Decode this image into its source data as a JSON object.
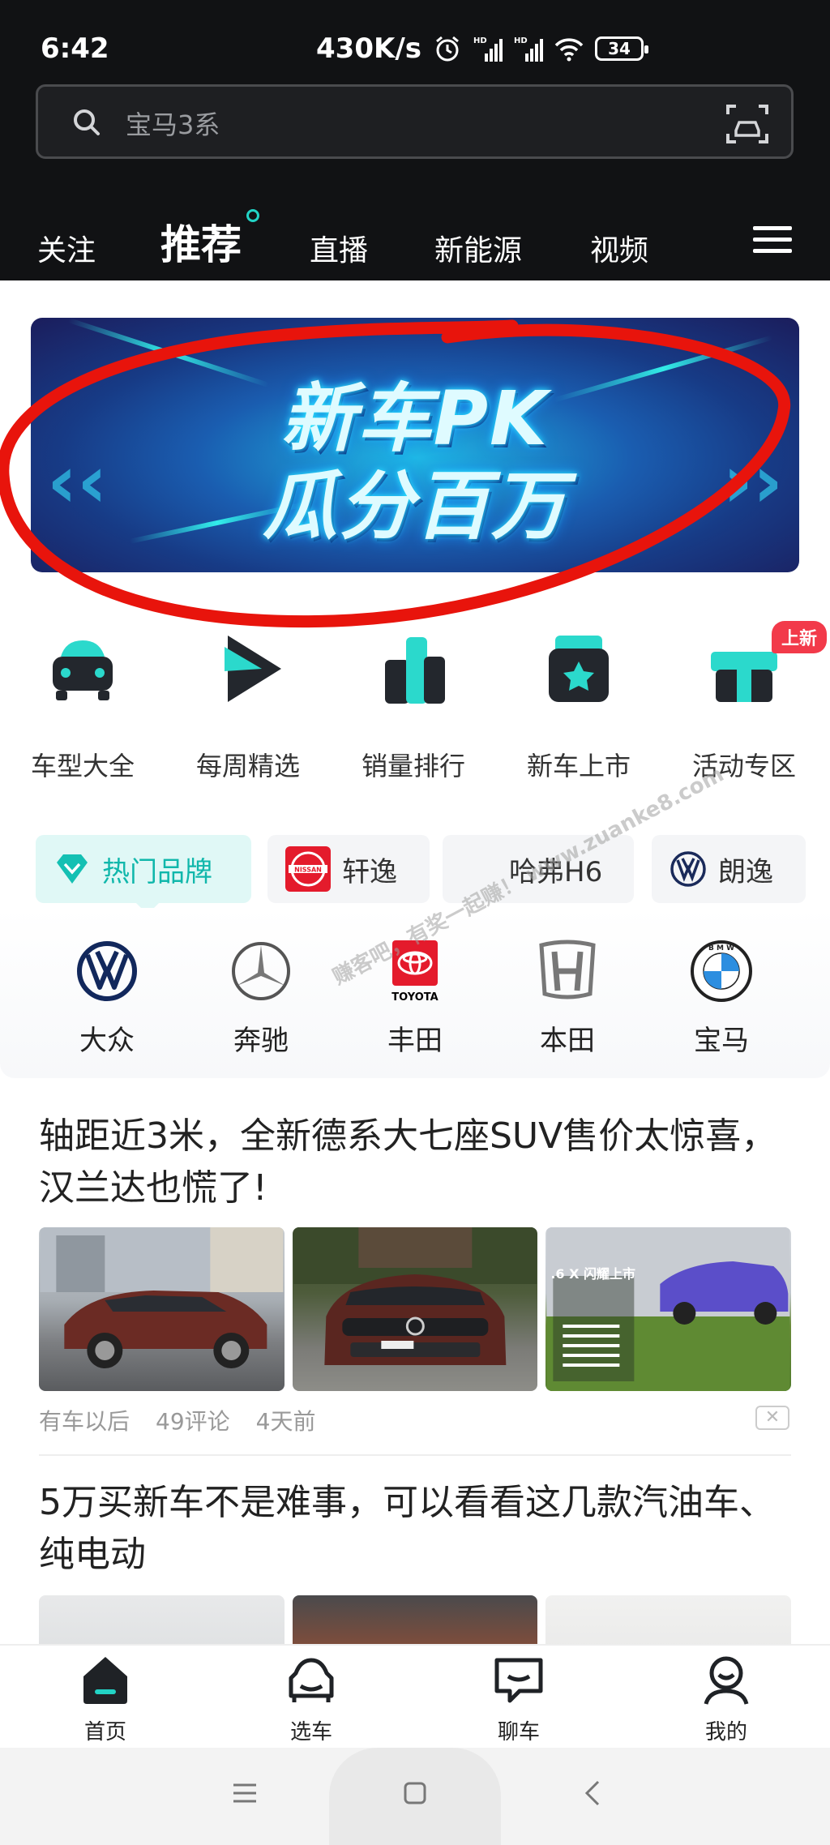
{
  "status_bar": {
    "time": "6:42",
    "speed": "430K/s",
    "battery": "34"
  },
  "search": {
    "placeholder": "宝马3系"
  },
  "tabs": [
    {
      "label": "关注"
    },
    {
      "label": "推荐",
      "active": true
    },
    {
      "label": "直播"
    },
    {
      "label": "新能源"
    },
    {
      "label": "视频"
    }
  ],
  "banner": {
    "line1": "新车PK",
    "line2": "瓜分百万"
  },
  "quick_entries": [
    {
      "label": "车型大全",
      "icon": "car-front-icon"
    },
    {
      "label": "每周精选",
      "icon": "play-icon"
    },
    {
      "label": "销量排行",
      "icon": "bar-chart-icon"
    },
    {
      "label": "新车上市",
      "icon": "star-box-icon"
    },
    {
      "label": "活动专区",
      "icon": "gift-icon",
      "badge": "上新"
    }
  ],
  "brand_chips": [
    {
      "label": "热门品牌",
      "icon": "diamond-icon",
      "active": true
    },
    {
      "label": "轩逸",
      "icon": "nissan-logo"
    },
    {
      "label": "哈弗H6",
      "icon": "haval-logo"
    },
    {
      "label": "朗逸",
      "icon": "vw-logo"
    }
  ],
  "hot_brands": [
    {
      "name": "大众",
      "logo": "vw-logo"
    },
    {
      "name": "奔驰",
      "logo": "mercedes-logo"
    },
    {
      "name": "丰田",
      "logo": "toyota-logo"
    },
    {
      "name": "本田",
      "logo": "honda-logo"
    },
    {
      "name": "宝马",
      "logo": "bmw-logo"
    }
  ],
  "watermark": "赚客吧，有奖一起赚！ www.zuanke8.com",
  "articles": [
    {
      "title": "轴距近3米，全新德系大七座SUV售价太惊喜，汉兰达也慌了!",
      "source": "有车以后",
      "comments": "49评论",
      "time": "4天前",
      "thumb_caption": ".6 X 闪耀上市"
    },
    {
      "title": "5万买新车不是难事，可以看看这几款汽油车、纯电动"
    }
  ],
  "bottom_nav": [
    {
      "label": "首页",
      "icon": "home-icon",
      "active": true
    },
    {
      "label": "选车",
      "icon": "car-select-icon"
    },
    {
      "label": "聊车",
      "icon": "chat-icon"
    },
    {
      "label": "我的",
      "icon": "profile-icon"
    }
  ],
  "colors": {
    "accent": "#22d3c5",
    "header_bg": "#111214",
    "badge": "#f23a4a",
    "circle": "#e8140c"
  }
}
